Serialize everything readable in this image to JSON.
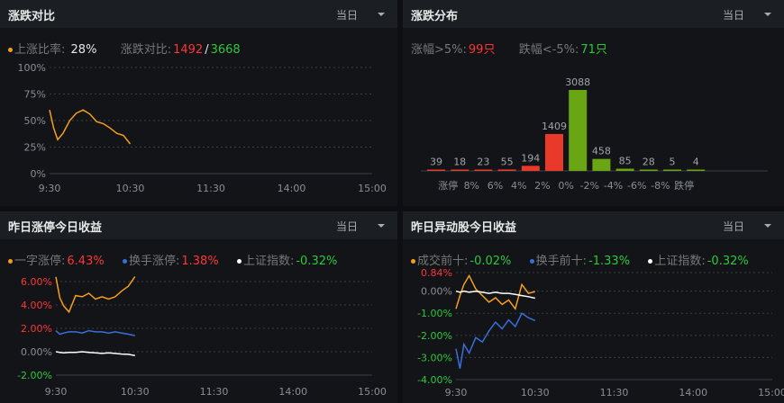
{
  "panels": {
    "p1": {
      "title": "涨跌对比",
      "dropdown": "当日"
    },
    "p2": {
      "title": "涨跌分布",
      "dropdown": "当日"
    },
    "p3": {
      "title": "昨日涨停今日收益",
      "dropdown": "当日"
    },
    "p4": {
      "title": "昨日异动股今日收益",
      "dropdown": "当日"
    }
  },
  "p1_legend": {
    "up_label": "上涨比率:",
    "up_value": "28%",
    "ratio_label": "涨跌对比:",
    "ratio_up": "1492",
    "ratio_sep": "/",
    "ratio_down": "3668"
  },
  "p2_legend": {
    "a_label": "涨幅>5%:",
    "a_value": "99只",
    "b_label": "跌幅<-5%:",
    "b_value": "71只"
  },
  "p3_legend": {
    "s1_label": "一字涨停:",
    "s1_value": "6.43%",
    "s2_label": "换手涨停:",
    "s2_value": "1.38%",
    "s3_label": "上证指数:",
    "s3_value": "-0.32%"
  },
  "p4_legend": {
    "s1_label": "成交前十:",
    "s1_value": "-0.02%",
    "s2_label": "换手前十:",
    "s2_value": "-1.33%",
    "s3_label": "上证指数:",
    "s3_value": "-0.32%"
  },
  "colors": {
    "orange": "#f59f1a",
    "blue": "#3a6fd8",
    "white": "#ffffff",
    "red": "#ff3535",
    "green": "#2ec73c",
    "bar_red": "#e8392b",
    "bar_green": "#6aa513"
  },
  "chart_data": [
    {
      "type": "line",
      "x_ticks": [
        "9:30",
        "10:30",
        "11:30",
        "14:00",
        "15:00"
      ],
      "y_ticks": [
        "100%",
        "75%",
        "50%",
        "25%",
        "0%"
      ],
      "ylim": [
        0,
        100
      ],
      "series": [
        {
          "name": "上涨比率",
          "color": "#f59f1a",
          "x": [
            "9:30",
            "9:33",
            "9:36",
            "9:40",
            "9:45",
            "9:50",
            "9:55",
            "10:00",
            "10:05",
            "10:10",
            "10:15",
            "10:20",
            "10:25",
            "10:30"
          ],
          "values": [
            60,
            43,
            32,
            38,
            50,
            57,
            60,
            56,
            49,
            47,
            43,
            38,
            36,
            28
          ]
        }
      ]
    },
    {
      "type": "bar",
      "categories": [
        "涨停",
        "8%",
        "6%",
        "4%",
        "2%",
        "0%",
        "-2%",
        "-4%",
        "-6%",
        "-8%",
        "跌停"
      ],
      "values": [
        39,
        18,
        23,
        55,
        194,
        1409,
        3088,
        458,
        85,
        28,
        5,
        4
      ],
      "value_labels": [
        "39",
        "18",
        "23",
        "55",
        "194",
        "1409",
        "3088",
        "458",
        "85",
        "28",
        "5",
        "4"
      ],
      "colors": [
        "#e8392b",
        "#e8392b",
        "#e8392b",
        "#e8392b",
        "#e8392b",
        "#e8392b",
        "#6aa513",
        "#6aa513",
        "#6aa513",
        "#6aa513",
        "#6aa513",
        "#6aa513"
      ]
    },
    {
      "type": "line",
      "x_ticks": [
        "9:30",
        "10:30",
        "11:30",
        "14:00",
        "15:00"
      ],
      "y_ticks": [
        "6.00%",
        "4.00%",
        "2.00%",
        "0.00%",
        "-2.00%"
      ],
      "ylim": [
        -2,
        7
      ],
      "series": [
        {
          "name": "一字涨停",
          "color": "#f59f1a",
          "x": [
            "9:30",
            "9:33",
            "9:36",
            "9:40",
            "9:45",
            "9:50",
            "9:55",
            "10:00",
            "10:05",
            "10:10",
            "10:15",
            "10:20",
            "10:25",
            "10:30"
          ],
          "values": [
            6.4,
            4.6,
            3.9,
            3.4,
            4.8,
            4.7,
            5.0,
            4.5,
            4.7,
            4.5,
            4.7,
            5.2,
            5.6,
            6.43
          ]
        },
        {
          "name": "换手涨停",
          "color": "#3a6fd8",
          "x": [
            "9:30",
            "9:33",
            "9:36",
            "9:40",
            "9:45",
            "9:50",
            "9:55",
            "10:00",
            "10:05",
            "10:10",
            "10:15",
            "10:20",
            "10:25",
            "10:30"
          ],
          "values": [
            1.8,
            1.5,
            1.6,
            1.7,
            1.7,
            1.6,
            1.8,
            1.7,
            1.7,
            1.6,
            1.7,
            1.6,
            1.5,
            1.38
          ]
        },
        {
          "name": "上证指数",
          "color": "#ffffff",
          "x": [
            "9:30",
            "9:33",
            "9:36",
            "9:40",
            "9:45",
            "9:50",
            "9:55",
            "10:00",
            "10:05",
            "10:10",
            "10:15",
            "10:20",
            "10:25",
            "10:30"
          ],
          "values": [
            0.0,
            -0.05,
            -0.1,
            -0.05,
            -0.05,
            0.0,
            -0.05,
            -0.1,
            -0.15,
            -0.1,
            -0.15,
            -0.2,
            -0.22,
            -0.32
          ]
        }
      ]
    },
    {
      "type": "line",
      "x_ticks": [
        "9:30",
        "10:30",
        "11:30",
        "14:00",
        "15:00"
      ],
      "y_ticks": [
        "0.84%",
        "0.00%",
        "-1.00%",
        "-2.00%",
        "-3.00%",
        "-4.00%"
      ],
      "ylim": [
        -4,
        0.84
      ],
      "series": [
        {
          "name": "成交前十",
          "color": "#f59f1a",
          "x": [
            "9:30",
            "9:33",
            "9:36",
            "9:40",
            "9:45",
            "9:50",
            "9:55",
            "10:00",
            "10:05",
            "10:10",
            "10:15",
            "10:20",
            "10:25",
            "10:30"
          ],
          "values": [
            -0.8,
            -0.2,
            0.3,
            0.7,
            0.1,
            -0.2,
            -0.5,
            -0.3,
            -0.6,
            -0.4,
            -0.8,
            0.3,
            -0.1,
            -0.02
          ]
        },
        {
          "name": "换手前十",
          "color": "#3a6fd8",
          "x": [
            "9:30",
            "9:33",
            "9:36",
            "9:40",
            "9:45",
            "9:50",
            "9:55",
            "10:00",
            "10:05",
            "10:10",
            "10:15",
            "10:20",
            "10:25",
            "10:30"
          ],
          "values": [
            -2.6,
            -3.5,
            -2.4,
            -2.8,
            -2.1,
            -2.3,
            -1.8,
            -1.4,
            -1.7,
            -1.3,
            -1.6,
            -1.0,
            -1.2,
            -1.33
          ]
        },
        {
          "name": "上证指数",
          "color": "#ffffff",
          "x": [
            "9:30",
            "9:33",
            "9:36",
            "9:40",
            "9:45",
            "9:50",
            "9:55",
            "10:00",
            "10:05",
            "10:10",
            "10:15",
            "10:20",
            "10:25",
            "10:30"
          ],
          "values": [
            0.0,
            -0.05,
            0.0,
            -0.05,
            0.0,
            -0.05,
            -0.1,
            -0.05,
            -0.1,
            -0.1,
            -0.15,
            -0.2,
            -0.25,
            -0.32
          ]
        }
      ]
    }
  ]
}
